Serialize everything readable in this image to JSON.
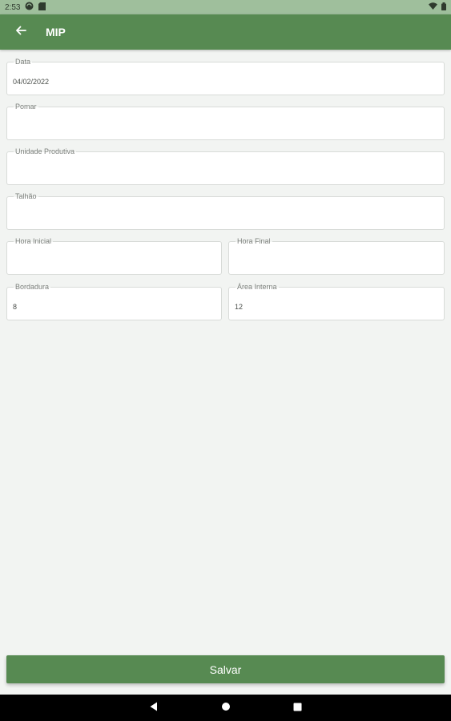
{
  "status_bar": {
    "time": "2:53",
    "icons": [
      "sync-icon",
      "sd-card-icon",
      "wifi-icon",
      "battery-icon"
    ]
  },
  "app_bar": {
    "title": "MIP",
    "back_icon": "arrow-left-icon",
    "color": "#578a52"
  },
  "form": {
    "data": {
      "label": "Data",
      "value": "04/02/2022"
    },
    "pomar": {
      "label": "Pomar",
      "value": ""
    },
    "unidade_produtiva": {
      "label": "Unidade Produtiva",
      "value": ""
    },
    "talhao": {
      "label": "Talhão",
      "value": ""
    },
    "hora_inicial": {
      "label": "Hora Inicial",
      "value": ""
    },
    "hora_final": {
      "label": "Hora Final",
      "value": ""
    },
    "bordadura": {
      "label": "Bordadura",
      "value": "8"
    },
    "area_interna": {
      "label": "Área Interna",
      "value": "12"
    }
  },
  "actions": {
    "save_label": "Salvar"
  },
  "nav_bar": {
    "icons": [
      "back-triangle-icon",
      "home-circle-icon",
      "recents-square-icon"
    ]
  }
}
